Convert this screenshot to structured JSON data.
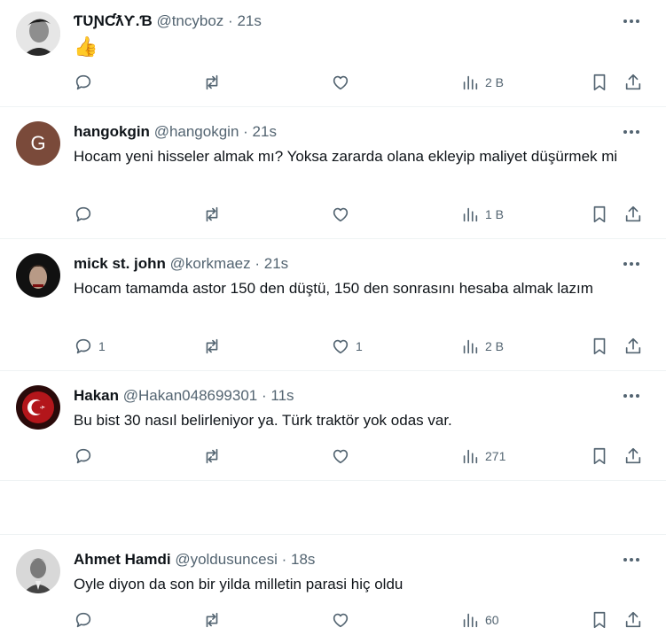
{
  "tweets": [
    {
      "name": "ƬƲƝƇƛƳ.Ɓ",
      "handle": "@tncyboz",
      "time": "21s",
      "text": "👍",
      "replies": "",
      "likes": "",
      "views": "2 B"
    },
    {
      "name": "hangokgin",
      "handle": "@hangokgin",
      "time": "21s",
      "avatar_letter": "G",
      "text": "Hocam yeni hisseler almak mı? Yoksa zararda olana ekleyip maliyet düşürmek mi",
      "replies": "",
      "likes": "",
      "views": "1 B"
    },
    {
      "name": "mick st. john",
      "handle": "@korkmaez",
      "time": "21s",
      "text": "Hocam tamamda astor 150 den düştü, 150 den sonrasını hesaba almak lazım",
      "replies": "1",
      "likes": "1",
      "views": "2 B"
    },
    {
      "name": "Hakan",
      "handle": "@Hakan048699301",
      "time": "11s",
      "text": "Bu bist 30 nasıl belirleniyor ya. Türk traktör yok odas var.",
      "replies": "",
      "likes": "",
      "views": "271"
    },
    {
      "name": "Ahmet Hamdi",
      "handle": "@yoldusuncesi",
      "time": "18s",
      "text": "Oyle diyon da son bir yilda milletin parasi hiç oldu",
      "replies": "",
      "likes": "",
      "views": "60"
    }
  ],
  "separator": "·",
  "colors": {
    "text": "#0f1419",
    "secondary": "#536471",
    "border": "#eff3f4",
    "avatar_g_bg": "#7a4a3a"
  }
}
